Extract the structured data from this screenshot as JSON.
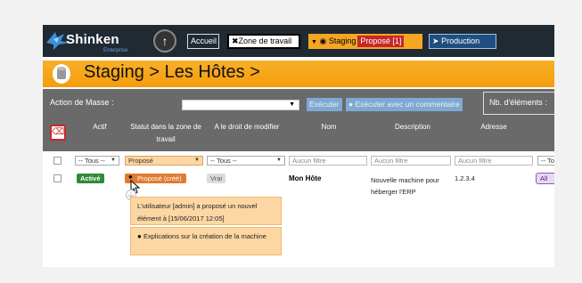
{
  "nav": {
    "logo": "Shinken",
    "logo_sub": "Enterprise",
    "accueil": "Accueil",
    "zone_travail": "Zone de travail",
    "staging": "Staging",
    "staging_badge": "Proposé [1]",
    "production": "Production"
  },
  "header": {
    "title": "Staging > Les Hôtes >"
  },
  "mass_action": {
    "label": "Action de Masse :",
    "select_value": "",
    "execute": "Exécuter",
    "execute_with_comment": "Exécuter avec un commentaire",
    "nb_elements_label": "Nb. d'éléments :"
  },
  "table": {
    "columns": {
      "actif": "Actif",
      "statut": "Statut dans la zone de travail",
      "droit": "A le droit de modifier",
      "nom": "Nom",
      "description": "Description",
      "adresse": "Adresse"
    },
    "filters": {
      "actif": "-- Tous --",
      "statut": "Proposé",
      "droit": "-- Tous --",
      "nom_placeholder": "Aucun filtre",
      "description_placeholder": "Aucun filtre",
      "adresse_placeholder": "Aucun filtre",
      "last": "-- To"
    },
    "rows": [
      {
        "actif": "Activé",
        "statut": "Proposé (créé)",
        "droit": "Vrai",
        "nom": "Mon Hôte",
        "description": "Nouvelle machine pour héberger l'ERP",
        "adresse": "1.2.3.4",
        "extra": "All"
      }
    ]
  },
  "tooltip": {
    "line1": "L'utilisateur [admin] a proposé un nouvel élément à [15/06/2017 12:05]",
    "line2": "Explications sur la création de la machine"
  },
  "colors": {
    "accent_orange": "#f5a623",
    "nav_bg": "#1f2a33",
    "active_green": "#2e8b34",
    "proposed_orange": "#e07b31",
    "staging_badge_red": "#c62828"
  }
}
